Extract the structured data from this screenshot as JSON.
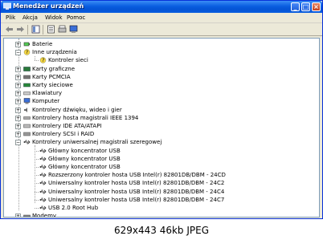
{
  "window": {
    "title": "Menedżer urządzeń",
    "min_label": "_",
    "max_label": "□",
    "close_label": "×"
  },
  "menu": [
    "Plik",
    "Akcja",
    "Widok",
    "Pomoc"
  ],
  "toolbar": {
    "icons": [
      "back-icon",
      "forward-icon",
      "view-icon",
      "properties-icon",
      "help-icon",
      "print-icon",
      "scan-hardware-icon"
    ]
  },
  "tree": {
    "items": [
      {
        "label": "Baterie",
        "icon": "battery-icon",
        "level": 1,
        "expander": "+"
      },
      {
        "label": "Inne urządzenia",
        "icon": "unknown-device-icon",
        "level": 1,
        "expander": "−"
      },
      {
        "label": "Kontroler sieci",
        "icon": "warning-device-icon",
        "level": 2,
        "expander": ""
      },
      {
        "label": "Karty graficzne",
        "icon": "display-adapter-icon",
        "level": 1,
        "expander": "+"
      },
      {
        "label": "Karty PCMCIA",
        "icon": "pcmcia-icon",
        "level": 1,
        "expander": "+"
      },
      {
        "label": "Karty sieciowe",
        "icon": "network-adapter-icon",
        "level": 1,
        "expander": "+"
      },
      {
        "label": "Klawiatury",
        "icon": "keyboard-icon",
        "level": 1,
        "expander": "+"
      },
      {
        "label": "Komputer",
        "icon": "computer-icon",
        "level": 1,
        "expander": "+"
      },
      {
        "label": "Kontrolery dźwięku, wideo i gier",
        "icon": "sound-icon",
        "level": 1,
        "expander": "+"
      },
      {
        "label": "Kontrolery hosta magistrali IEEE 1394",
        "icon": "ieee1394-icon",
        "level": 1,
        "expander": "+"
      },
      {
        "label": "Kontrolery IDE ATA/ATAPI",
        "icon": "ide-icon",
        "level": 1,
        "expander": "+"
      },
      {
        "label": "Kontrolery SCSI i RAID",
        "icon": "scsi-icon",
        "level": 1,
        "expander": "+"
      },
      {
        "label": "Kontrolery uniwersalnej magistrali szeregowej",
        "icon": "usb-icon",
        "level": 1,
        "expander": "−"
      },
      {
        "label": "Główny koncentrator USB",
        "icon": "usb-icon",
        "level": 2,
        "expander": ""
      },
      {
        "label": "Główny koncentrator USB",
        "icon": "usb-icon",
        "level": 2,
        "expander": ""
      },
      {
        "label": "Główny koncentrator USB",
        "icon": "usb-icon",
        "level": 2,
        "expander": ""
      },
      {
        "label": "Rozszerzony kontroler hosta USB Intel(r) 82801DB/DBM - 24CD",
        "icon": "usb-icon",
        "level": 2,
        "expander": ""
      },
      {
        "label": "Uniwersalny kontroler hosta USB Intel(r) 82801DB/DBM - 24C2",
        "icon": "usb-icon",
        "level": 2,
        "expander": ""
      },
      {
        "label": "Uniwersalny kontroler hosta USB Intel(r) 82801DB/DBM - 24C4",
        "icon": "usb-icon",
        "level": 2,
        "expander": ""
      },
      {
        "label": "Uniwersalny kontroler hosta USB Intel(r) 82801DB/DBM - 24C7",
        "icon": "usb-icon",
        "level": 2,
        "expander": ""
      },
      {
        "label": "USB 2.0 Root Hub",
        "icon": "usb-icon",
        "level": 2,
        "expander": ""
      },
      {
        "label": "Modemy",
        "icon": "modem-icon",
        "level": 1,
        "expander": "+"
      }
    ]
  },
  "caption": "629x443 46kb JPEG",
  "colors": {
    "titlebar": "#0a5ee0",
    "window_bg": "#ece9d8",
    "tree_bg": "#ffffff"
  }
}
